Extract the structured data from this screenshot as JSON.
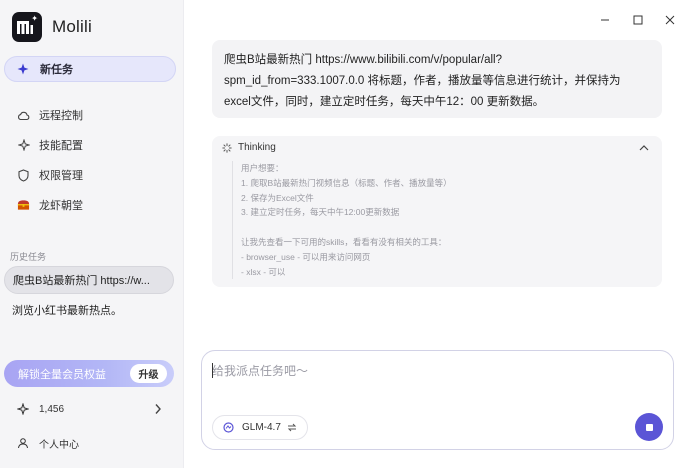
{
  "app": {
    "name": "Molili"
  },
  "sidebar": {
    "new_task": "新任务",
    "nav": [
      {
        "label": "远程控制",
        "icon": "cloud-icon"
      },
      {
        "label": "技能配置",
        "icon": "sparkle-icon"
      },
      {
        "label": "权限管理",
        "icon": "shield-icon"
      },
      {
        "label": "龙虾朝堂",
        "icon": "treasure-chest-icon"
      }
    ],
    "history_title": "历史任务",
    "history": [
      {
        "label": "爬虫B站最新热门 https://w..."
      },
      {
        "label": "浏览小红书最新热点。"
      }
    ],
    "promo": {
      "label": "解锁全量会员权益",
      "button": "升级"
    },
    "credits": "1,456",
    "profile": "个人中心"
  },
  "chat": {
    "user_message": {
      "lines": [
        "爬虫B站最新热门 https://www.bilibili.com/v/popular/all?",
        "spm_id_from=333.1007.0.0 将标题，作者，播放量等信息进行统计，并保持为",
        "excel文件，同时，建立定时任务，每天中午12：00 更新数据。"
      ]
    },
    "thinking": {
      "title": "Thinking",
      "lines": [
        "用户想要：",
        "1. 爬取B站最新热门视频信息（标题、作者、播放量等）",
        "2. 保存为Excel文件",
        "3. 建立定时任务，每天中午12:00更新数据",
        "",
        "让我先查看一下可用的skills，看看有没有相关的工具：",
        "- browser_use - 可以用来访问网页",
        "- xlsx - 可以"
      ]
    }
  },
  "composer": {
    "placeholder": "给我派点任务吧～",
    "value": "",
    "model": "GLM-4.7"
  },
  "colors": {
    "accent": "#5b55d6",
    "promo": "#a8a4f3"
  }
}
